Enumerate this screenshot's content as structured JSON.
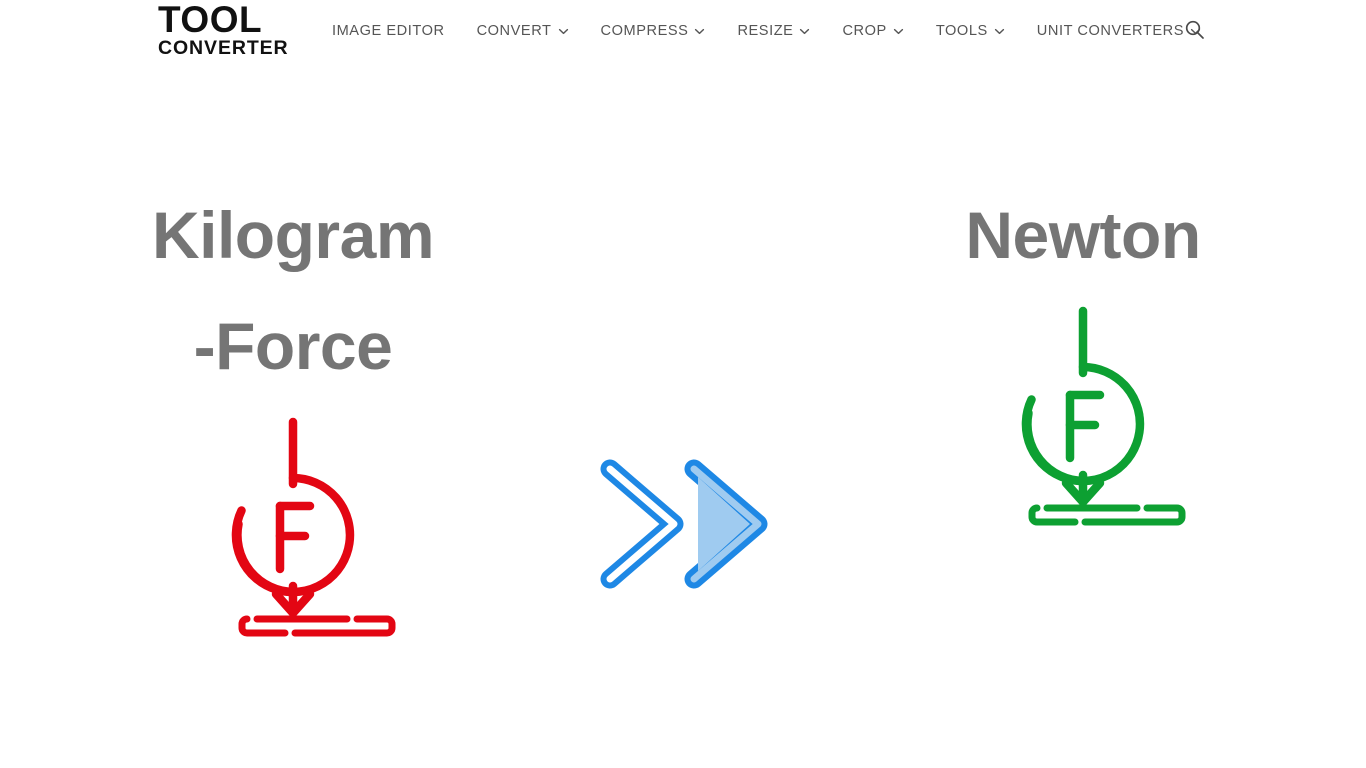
{
  "header": {
    "brand": {
      "line1": "TOOL",
      "line2": "CONVERTER",
      "name": "Tool Converter"
    },
    "nav_items": [
      {
        "label": "IMAGE EDITOR",
        "has_dropdown": false
      },
      {
        "label": "CONVERT",
        "has_dropdown": true
      },
      {
        "label": "COMPRESS",
        "has_dropdown": true
      },
      {
        "label": "RESIZE",
        "has_dropdown": true
      },
      {
        "label": "CROP",
        "has_dropdown": true
      },
      {
        "label": "TOOLS",
        "has_dropdown": true
      },
      {
        "label": "UNIT CONVERTERS",
        "has_dropdown": true
      }
    ],
    "search": {
      "icon": "search-icon",
      "label": "Search"
    }
  },
  "converter": {
    "from_unit": {
      "title": "Kilogram-Force",
      "icon": "force-arrow-icon",
      "icon_letter": "F",
      "color": "#E30613"
    },
    "to_unit": {
      "title": "Newton",
      "icon": "force-arrow-icon",
      "icon_letter": "F",
      "color": "#0DA032"
    },
    "direction_icon": {
      "name": "double-chevron-right-icon",
      "stroke_color": "#1E88E5",
      "fill_color": "#9FCBF0"
    }
  },
  "colors": {
    "background": "#FFFFFF",
    "brand_text": "#111111",
    "nav_text": "#555555",
    "title_text": "#757575",
    "red": "#E30613",
    "green": "#0DA032",
    "blue": "#1E88E5",
    "blue_light": "#9FCBF0"
  }
}
